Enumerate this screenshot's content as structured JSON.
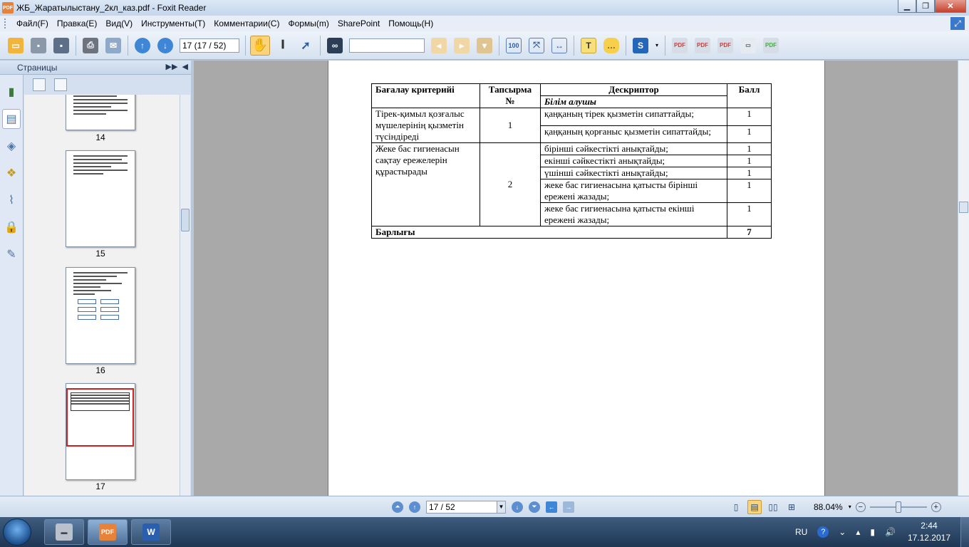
{
  "window": {
    "title": "ЖБ_Жаратылыстану_2кл_каз.pdf - Foxit Reader",
    "app_icon_text": "PDF"
  },
  "menu": [
    "Файл(F)",
    "Правка(E)",
    "Вид(V)",
    "Инструменты(T)",
    "Комментарии(C)",
    "Формы(m)",
    "SharePoint",
    "Помощь(H)"
  ],
  "toolbar": {
    "page_field": "17 (17 / 52)",
    "search_placeholder": ""
  },
  "left_panel": {
    "title": "Страницы",
    "thumbnails": [
      {
        "label": "14"
      },
      {
        "label": "15"
      },
      {
        "label": "16"
      },
      {
        "label": "17"
      }
    ]
  },
  "document": {
    "table": {
      "headers": {
        "criteria": "Бағалау критерийі",
        "task_no": "Тапсырма №",
        "descriptor": "Дескриптор",
        "score": "Балл",
        "learner": "Білім алушы"
      },
      "rows": [
        {
          "criteria": "Тірек-қимыл қозғалыс мүшелерінің қызметін түсіндіреді",
          "task": "1",
          "items": [
            {
              "descriptor": "қаңқаның тірек қызметін сипаттайды;",
              "score": "1"
            },
            {
              "descriptor": "қаңқаның қорғаныс қызметін сипаттайды;",
              "score": "1"
            }
          ]
        },
        {
          "criteria": "Жеке бас гигиенасын сақтау ережелерін құрастырады",
          "task": "2",
          "items": [
            {
              "descriptor": "бірінші сәйкестікті анықтайды;",
              "score": "1"
            },
            {
              "descriptor": "екінші сәйкестікті анықтайды;",
              "score": "1"
            },
            {
              "descriptor": "үшінші сәйкестікті анықтайды;",
              "score": "1"
            },
            {
              "descriptor": "жеке бас гигиенасына қатысты бірінші ережені жазады;",
              "score": "1"
            },
            {
              "descriptor": "жеке бас гигиенасына қатысты екінші ережені жазады;",
              "score": "1"
            }
          ]
        }
      ],
      "total_label": "Барлығы",
      "total_score": "7"
    }
  },
  "statusbar": {
    "page_value": "17 / 52",
    "zoom": "88.04%"
  },
  "taskbar": {
    "language": "RU",
    "time": "2:44",
    "date": "17.12.2017"
  }
}
